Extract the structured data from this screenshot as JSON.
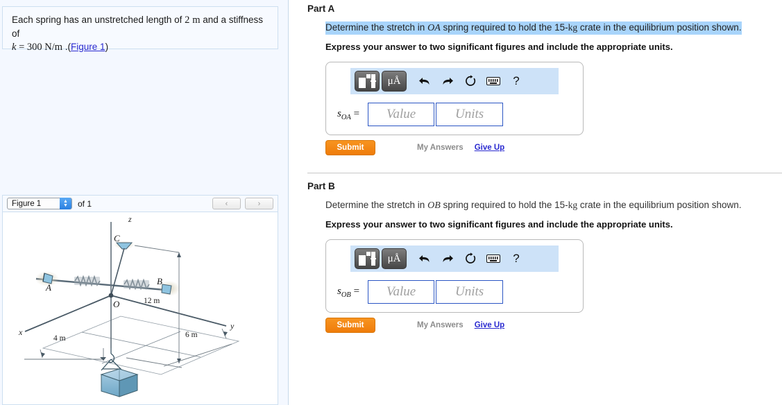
{
  "left": {
    "problem": {
      "line1_a": "Each spring has an unstretched length of ",
      "line1_num": "2",
      "line1_unit": "m",
      "line1_b": " and a stiffness of",
      "line2_k": "k",
      "line2_eq": " = 300 ",
      "line2_unit": "N/m",
      "line2_dot": " .(",
      "figure_link": "Figure 1",
      "line2_close": ")"
    },
    "figure_nav": {
      "select_value": "Figure 1",
      "of_label": "of 1",
      "prev_label": "‹",
      "next_label": "›"
    },
    "figure": {
      "axis_x": "x",
      "axis_y": "y",
      "axis_z": "z",
      "point_A": "A",
      "point_B": "B",
      "point_C": "C",
      "origin": "O",
      "dim_4m": "4 m",
      "dim_6m": "6 m",
      "dim_12m": "12 m"
    }
  },
  "parts": [
    {
      "title": "Part A",
      "question_pre": "Determine the stretch in ",
      "question_var": "OA",
      "question_mid": " spring required to hold the 15-",
      "question_unit": "kg",
      "question_post": " crate in the equilibrium position shown.",
      "highlighted": true,
      "instruction": "Express your answer to two significant figures and include the appropriate units.",
      "answer_label_base": "s",
      "answer_label_sub": "OA",
      "answer_label_eq": " =",
      "value_placeholder": "Value",
      "value_current": "",
      "units_placeholder": "Units",
      "units_current": "",
      "submit_label": "Submit",
      "my_answers_label": "My Answers",
      "give_up_label": "Give Up"
    },
    {
      "title": "Part B",
      "question_pre": "Determine the stretch in ",
      "question_var": "OB",
      "question_mid": " spring required to hold the 15-",
      "question_unit": "kg",
      "question_post": " crate in the equilibrium position shown.",
      "highlighted": false,
      "instruction": "Express your answer to two significant figures and include the appropriate units.",
      "answer_label_base": "s",
      "answer_label_sub": "OB",
      "answer_label_eq": " =",
      "value_placeholder": "Value",
      "value_current": "",
      "units_placeholder": "Units",
      "units_current": "",
      "submit_label": "Submit",
      "my_answers_label": "My Answers",
      "give_up_label": "Give Up"
    }
  ],
  "toolbar": {
    "template_icon": "template-icon",
    "units_label": "μÅ",
    "undo_icon": "⬅",
    "redo_icon": "➡",
    "reset_icon": "↻",
    "keyboard_icon": "keyboard-icon",
    "help_label": "?"
  },
  "colors": {
    "accent_orange": "#ef7c0a",
    "link_blue": "#2a2ad0",
    "highlight_blue": "#a8d4fb",
    "toolbar_blue": "#cde2f8",
    "panel_blue": "#f4f8ff"
  }
}
